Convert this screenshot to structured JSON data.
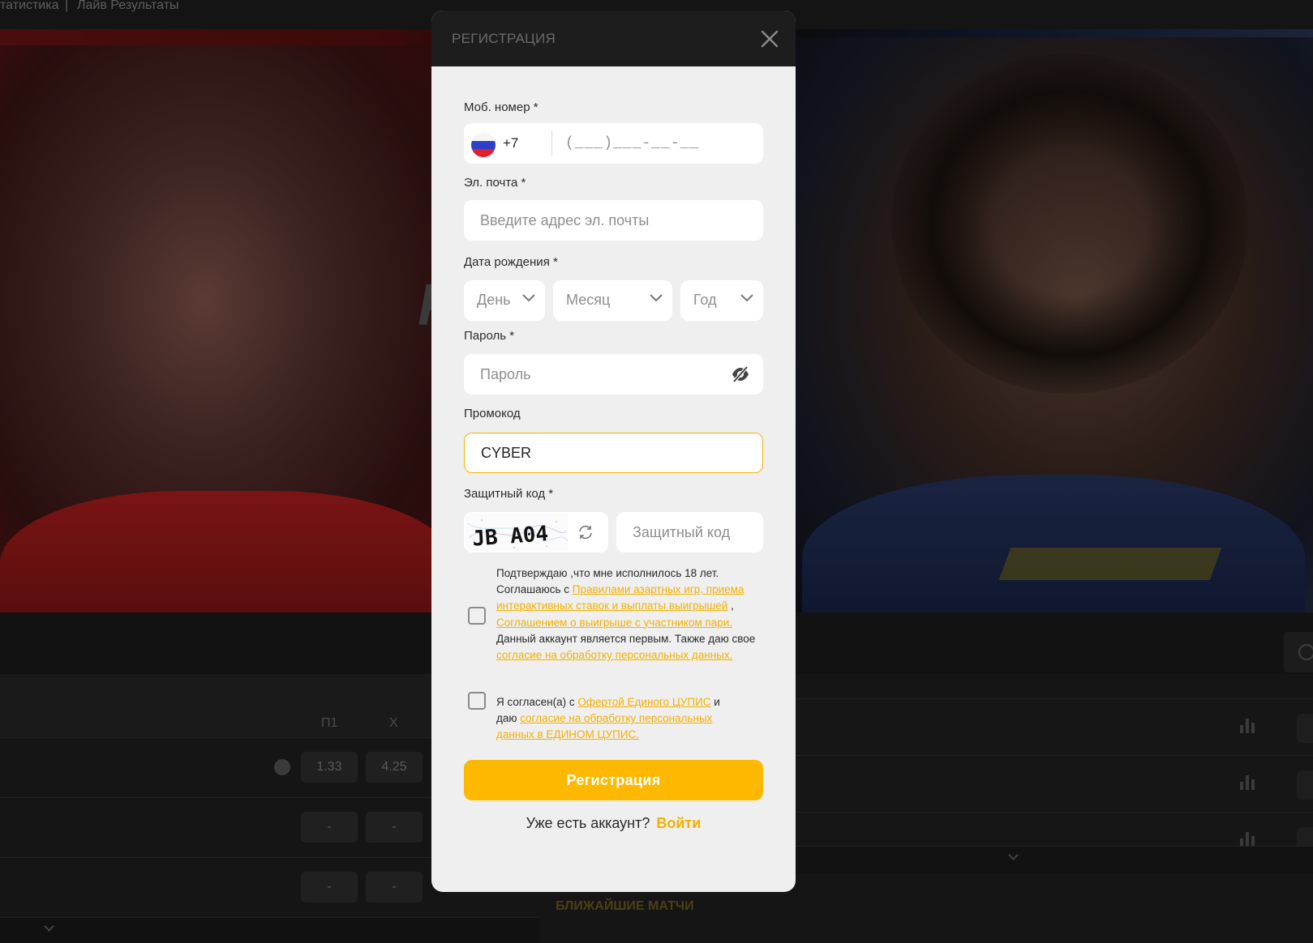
{
  "background": {
    "nav": {
      "item_1": "татистика",
      "divider": "|",
      "item_2": "Лайв Результаты"
    },
    "banner_word": "F  T",
    "odds_headers": {
      "p1": "П1",
      "x": "X"
    },
    "odds_rows": [
      {
        "p1": "1.33",
        "x": "4.25"
      },
      {
        "p1": "-",
        "x": "-"
      },
      {
        "p1": "-",
        "x": "-"
      }
    ],
    "nearest_matches": "БЛИЖАЙШИЕ МАТЧИ"
  },
  "modal": {
    "title": "РЕГИСТРАЦИЯ",
    "phone": {
      "label": "Моб. номер *",
      "country": "ru-flag-icon",
      "dial_code": "+7",
      "placeholder": "(___)___-__-__"
    },
    "email": {
      "label": "Эл. почта *",
      "placeholder": "Введите адрес эл. почты"
    },
    "birthdate": {
      "label": "Дата рождения *",
      "day": "День",
      "month": "Месяц",
      "year": "Год"
    },
    "password": {
      "label": "Пароль *",
      "placeholder": "Пароль"
    },
    "promo": {
      "label": "Промокод",
      "value": "CYBER"
    },
    "captcha": {
      "label": "Защитный код *",
      "image_text": "JB A04",
      "placeholder": "Защитный код"
    },
    "consent_1": {
      "t1": "Подтверждаю ,что мне исполнилось 18 лет. Соглашаюсь с ",
      "link1": "Правилами азартных игр, приема интерактивных ставок и выплаты выигрышей",
      "t2": " , ",
      "link2": "Соглашением о выигрыше с участником пари.",
      "t3": " Данный аккаунт является первым. Также даю свое ",
      "link3": "согласие на обработку персональных данных."
    },
    "consent_2": {
      "t1": "Я согласен(а) с ",
      "link1": "Офертой Единого ЦУПИС",
      "t2": " и даю ",
      "link2": "согласие на обработку персональных данных в ЕДИНОМ ЦУПИС."
    },
    "submit_label": "Регистрация",
    "login_prompt": "Уже есть аккаунт?",
    "login_link": "Войти"
  },
  "colors": {
    "accent": "#ffb800",
    "modal_bg": "#efefef",
    "header_bg": "#1d1d1d",
    "link": "#f4b000"
  }
}
